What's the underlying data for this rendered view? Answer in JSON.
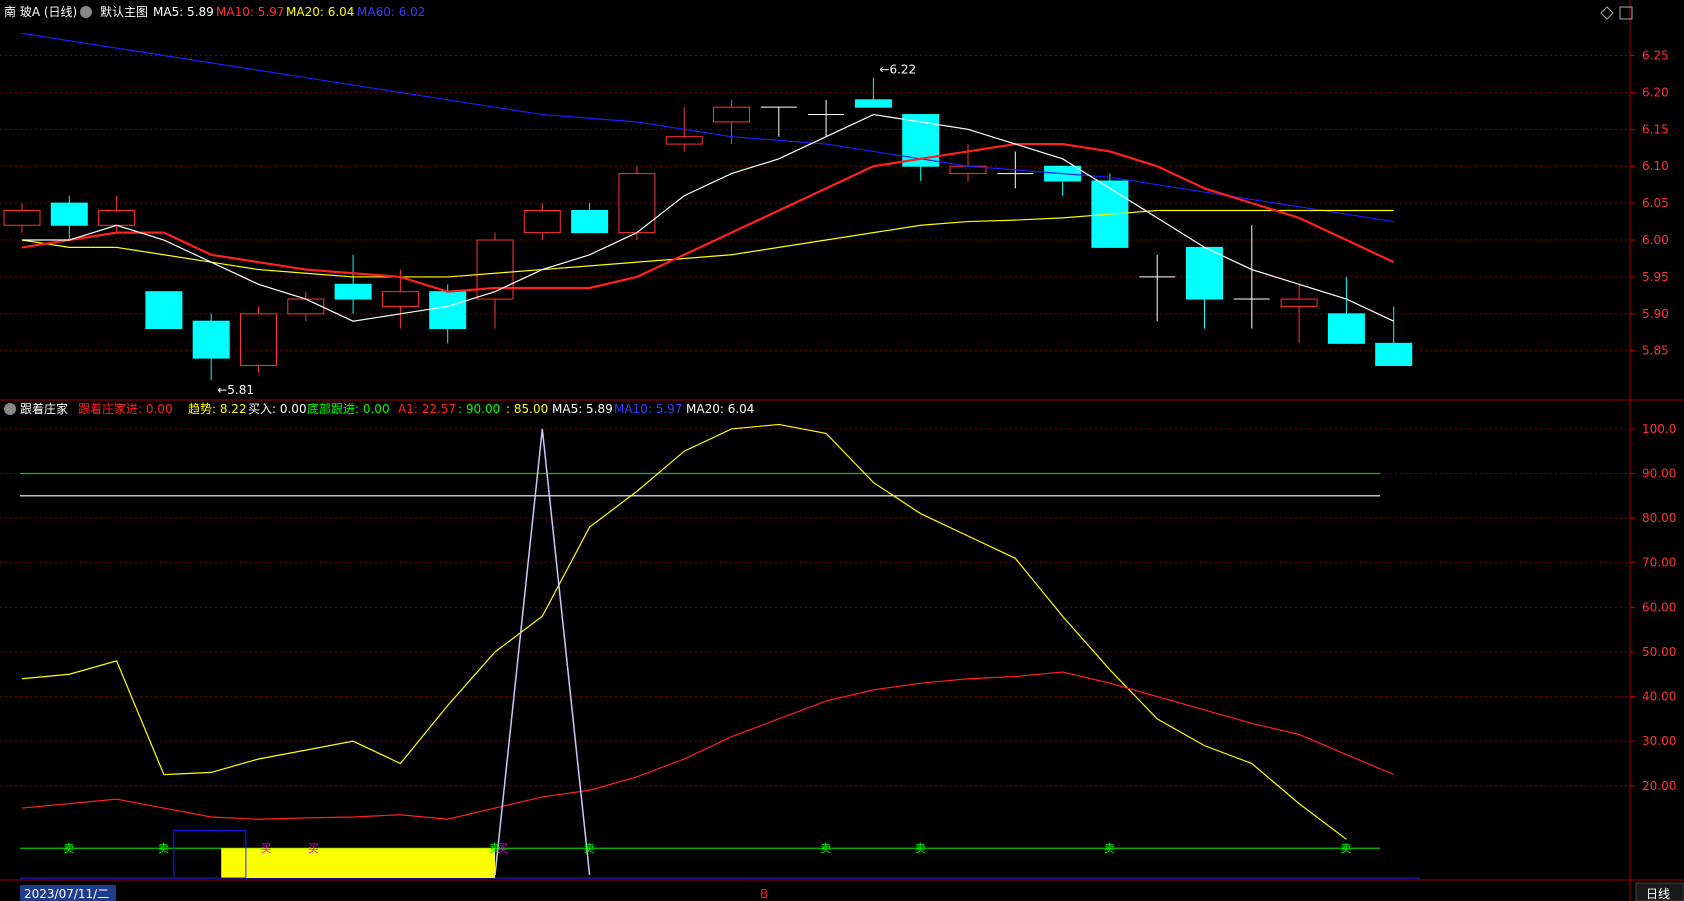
{
  "header": {
    "stock_name": "南 玻A (日线)",
    "main_indicator_label": "默认主图",
    "ma5": "MA5: 5.89",
    "ma10": "MA10: 5.97",
    "ma20": "MA20: 6.04",
    "ma60": "MA60: 6.02",
    "collapse_icon": "chevron-down-icon",
    "settings_icons": [
      "diamond-icon",
      "square-icon"
    ]
  },
  "sub_header": {
    "indicator_name": "跟着庄家",
    "entry": "跟着庄家进: 0.00",
    "trend": "趋势: 8.22",
    "buy": "买入: 0.00",
    "bottom": "底部跟进: 0.00",
    "a1_a": "A1: 22.57",
    "a1_b": ": 90.00",
    "a1_c": ": 85.00",
    "ma5": "MA5: 5.89",
    "ma10": "MA10: 5.97",
    "ma20": "MA20: 6.04"
  },
  "footer": {
    "date": "2023/07/11/二",
    "period_button": "日线",
    "marker": "B"
  },
  "colors": {
    "up": "#ff3232",
    "down": "#00ffff",
    "ma5": "#ffffff",
    "ma10": "#ff2020",
    "ma20": "#ffff00",
    "ma60": "#1e1eff",
    "grid": "#800000"
  },
  "chart_data": [
    {
      "type": "candlestick",
      "ylim": [
        5.79,
        6.29
      ],
      "y_ticks": [
        "5.85",
        "5.90",
        "5.95",
        "6.00",
        "6.05",
        "6.10",
        "6.15",
        "6.20",
        "6.25"
      ],
      "candles": [
        {
          "o": 6.02,
          "h": 6.05,
          "l": 6.01,
          "c": 6.04
        },
        {
          "o": 6.05,
          "h": 6.06,
          "l": 6.0,
          "c": 6.02
        },
        {
          "o": 6.02,
          "h": 6.06,
          "l": 6.01,
          "c": 6.04
        },
        {
          "o": 5.93,
          "h": 5.93,
          "l": 5.88,
          "c": 5.88
        },
        {
          "o": 5.89,
          "h": 5.9,
          "l": 5.81,
          "c": 5.84
        },
        {
          "o": 5.83,
          "h": 5.91,
          "l": 5.82,
          "c": 5.9
        },
        {
          "o": 5.9,
          "h": 5.93,
          "l": 5.89,
          "c": 5.92
        },
        {
          "o": 5.94,
          "h": 5.98,
          "l": 5.9,
          "c": 5.92
        },
        {
          "o": 5.91,
          "h": 5.96,
          "l": 5.88,
          "c": 5.93
        },
        {
          "o": 5.93,
          "h": 5.94,
          "l": 5.86,
          "c": 5.88
        },
        {
          "o": 5.92,
          "h": 6.01,
          "l": 5.88,
          "c": 6.0
        },
        {
          "o": 6.01,
          "h": 6.05,
          "l": 6.0,
          "c": 6.04
        },
        {
          "o": 6.04,
          "h": 6.05,
          "l": 6.01,
          "c": 6.01
        },
        {
          "o": 6.01,
          "h": 6.1,
          "l": 6.0,
          "c": 6.09
        },
        {
          "o": 6.13,
          "h": 6.18,
          "l": 6.12,
          "c": 6.14
        },
        {
          "o": 6.16,
          "h": 6.19,
          "l": 6.13,
          "c": 6.18
        },
        {
          "o": 6.18,
          "h": 6.18,
          "l": 6.14,
          "c": 6.18
        },
        {
          "o": 6.17,
          "h": 6.19,
          "l": 6.14,
          "c": 6.17
        },
        {
          "o": 6.19,
          "h": 6.22,
          "l": 6.18,
          "c": 6.18
        },
        {
          "o": 6.17,
          "h": 6.17,
          "l": 6.08,
          "c": 6.1
        },
        {
          "o": 6.09,
          "h": 6.13,
          "l": 6.08,
          "c": 6.1
        },
        {
          "o": 6.09,
          "h": 6.12,
          "l": 6.07,
          "c": 6.09
        },
        {
          "o": 6.1,
          "h": 6.1,
          "l": 6.06,
          "c": 6.08
        },
        {
          "o": 6.08,
          "h": 6.09,
          "l": 5.99,
          "c": 5.99
        },
        {
          "o": 5.95,
          "h": 5.98,
          "l": 5.89,
          "c": 5.95
        },
        {
          "o": 5.99,
          "h": 5.99,
          "l": 5.88,
          "c": 5.92
        },
        {
          "o": 5.92,
          "h": 6.02,
          "l": 5.88,
          "c": 5.92
        },
        {
          "o": 5.91,
          "h": 5.94,
          "l": 5.86,
          "c": 5.92
        },
        {
          "o": 5.9,
          "h": 5.95,
          "l": 5.86,
          "c": 5.86
        },
        {
          "o": 5.86,
          "h": 5.91,
          "l": 5.83,
          "c": 5.83
        }
      ],
      "ma5": [
        6.0,
        6.0,
        6.02,
        6.0,
        5.97,
        5.94,
        5.92,
        5.89,
        5.9,
        5.91,
        5.93,
        5.96,
        5.98,
        6.01,
        6.06,
        6.09,
        6.11,
        6.14,
        6.17,
        6.16,
        6.15,
        6.13,
        6.11,
        6.07,
        6.03,
        5.99,
        5.96,
        5.94,
        5.92,
        5.89
      ],
      "ma10": [
        5.99,
        6.0,
        6.01,
        6.01,
        5.98,
        5.97,
        5.96,
        5.955,
        5.95,
        5.93,
        5.935,
        5.935,
        5.935,
        5.95,
        5.98,
        6.01,
        6.04,
        6.07,
        6.1,
        6.11,
        6.12,
        6.13,
        6.13,
        6.12,
        6.1,
        6.07,
        6.05,
        6.03,
        6.0,
        5.97
      ],
      "ma20": [
        6.0,
        5.99,
        5.99,
        5.98,
        5.97,
        5.96,
        5.955,
        5.95,
        5.95,
        5.95,
        5.955,
        5.96,
        5.965,
        5.97,
        5.975,
        5.98,
        5.99,
        6.0,
        6.01,
        6.02,
        6.025,
        6.027,
        6.03,
        6.035,
        6.04,
        6.04,
        6.04,
        6.04,
        6.04,
        6.04
      ],
      "ma60": [
        6.28,
        6.27,
        6.26,
        6.25,
        6.24,
        6.23,
        6.22,
        6.21,
        6.2,
        6.19,
        6.18,
        6.17,
        6.165,
        6.16,
        6.15,
        6.14,
        6.135,
        6.13,
        6.12,
        6.11,
        6.1,
        6.095,
        6.09,
        6.085,
        6.075,
        6.065,
        6.055,
        6.045,
        6.035,
        6.025
      ],
      "annotations": [
        {
          "index": 18,
          "price": 6.22,
          "label": "6.22"
        },
        {
          "index": 4,
          "price": 5.81,
          "label": "5.81"
        }
      ]
    },
    {
      "type": "line",
      "ylim": [
        0,
        102
      ],
      "y_ticks": [
        "20.00",
        "30.00",
        "40.00",
        "50.00",
        "60.00",
        "70.00",
        "80.00",
        "90.00",
        "100.0"
      ],
      "series": [
        {
          "color": "#ffff00",
          "values": [
            44,
            45,
            48,
            22.5,
            23,
            26,
            28,
            30,
            25,
            38,
            50,
            58,
            78,
            86,
            95,
            100,
            101,
            99,
            88,
            81,
            76,
            71,
            58,
            46,
            35,
            29,
            25,
            16,
            8
          ]
        },
        {
          "color": "#ff2020",
          "values": [
            15,
            16,
            17,
            15,
            13,
            12.5,
            12.8,
            13,
            13.5,
            12.5,
            15,
            17.5,
            19,
            22,
            26,
            31,
            35,
            39,
            41.5,
            43,
            44,
            44.5,
            45.5,
            43,
            40,
            37,
            34,
            31.5,
            27,
            22.5
          ]
        },
        {
          "color": "#c8c8ff",
          "values": [
            null,
            null,
            null,
            null,
            null,
            null,
            null,
            null,
            null,
            null,
            0,
            100,
            0
          ]
        }
      ],
      "h_lines": [
        {
          "value": 90,
          "color": "#00c800"
        },
        {
          "value": 85,
          "color": "#ffffff"
        },
        {
          "value": 6,
          "color": "#00c800"
        }
      ],
      "sell_labels": [
        "卖",
        "卖",
        "卖",
        "卖",
        "卖",
        "卖",
        "卖",
        "卖"
      ],
      "buy_labels": [
        "买",
        "买",
        "买"
      ]
    }
  ]
}
